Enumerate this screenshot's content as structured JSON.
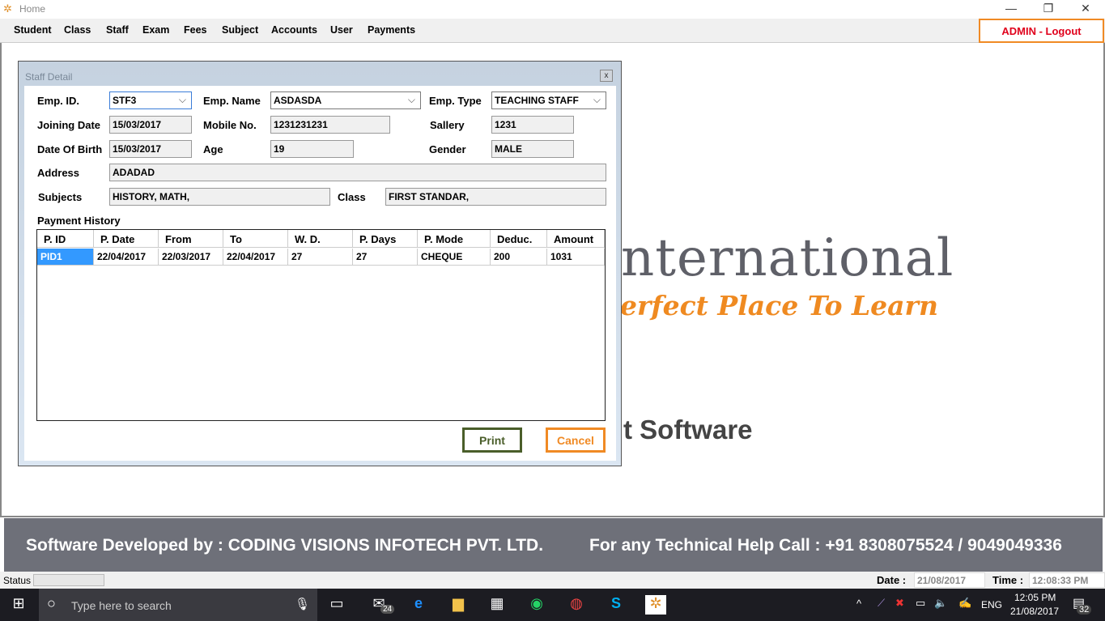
{
  "window": {
    "title": "Home",
    "minimize": "—",
    "restore": "❐",
    "close": "✕"
  },
  "menu": [
    "Student",
    "Class",
    "Staff",
    "Exam",
    "Fees",
    "Subject",
    "Accounts",
    "User",
    "Payments"
  ],
  "logout": "ADMIN - Logout",
  "background": {
    "line1": "nternational",
    "line2": "erfect Place To Learn",
    "line3": "t Software"
  },
  "dialog": {
    "title": "Staff Detail",
    "close": "x",
    "labels": {
      "emp_id": "Emp. ID.",
      "emp_name": "Emp. Name",
      "emp_type": "Emp. Type",
      "joining": "Joining Date",
      "mobile": "Mobile No.",
      "salary": "Sallery",
      "dob": "Date Of Birth",
      "age": "Age",
      "gender": "Gender",
      "address": "Address",
      "subjects": "Subjects",
      "class": "Class",
      "history": "Payment History"
    },
    "values": {
      "emp_id": "STF3",
      "emp_name": "ASDASDA",
      "emp_type": "TEACHING STAFF",
      "joining": "15/03/2017",
      "mobile": "1231231231",
      "salary": "1231",
      "dob": "15/03/2017",
      "age": "19",
      "gender": "MALE",
      "address": "ADADAD",
      "subjects": "HISTORY, MATH,",
      "class": "FIRST STANDAR,"
    },
    "table": {
      "headers": [
        "P. ID",
        "P. Date",
        "From",
        "To",
        "W. D.",
        "P. Days",
        "P. Mode",
        "Deduc.",
        "Amount"
      ],
      "rows": [
        [
          "PID1",
          "22/04/2017",
          "22/03/2017",
          "22/04/2017",
          "27",
          "27",
          "CHEQUE",
          "200",
          "1031"
        ]
      ]
    },
    "print": "Print",
    "cancel": "Cancel"
  },
  "footer": {
    "left": "Software Developed by : CODING VISIONS INFOTECH PVT. LTD.",
    "right": "For any Technical Help Call : +91 8308075524 / 9049049336"
  },
  "status": {
    "label": "Status",
    "date_label": "Date :",
    "date": "21/08/2017",
    "time_label": "Time :",
    "time": "12:08:33 PM"
  },
  "taskbar": {
    "search": "Type here to search",
    "mail_badge": "24",
    "lang": "ENG",
    "time": "12:05 PM",
    "date": "21/08/2017",
    "notif": "32"
  },
  "colors": {
    "accent": "#f08a24",
    "print_border": "#4a5e2a",
    "footer": "#6e7079"
  }
}
